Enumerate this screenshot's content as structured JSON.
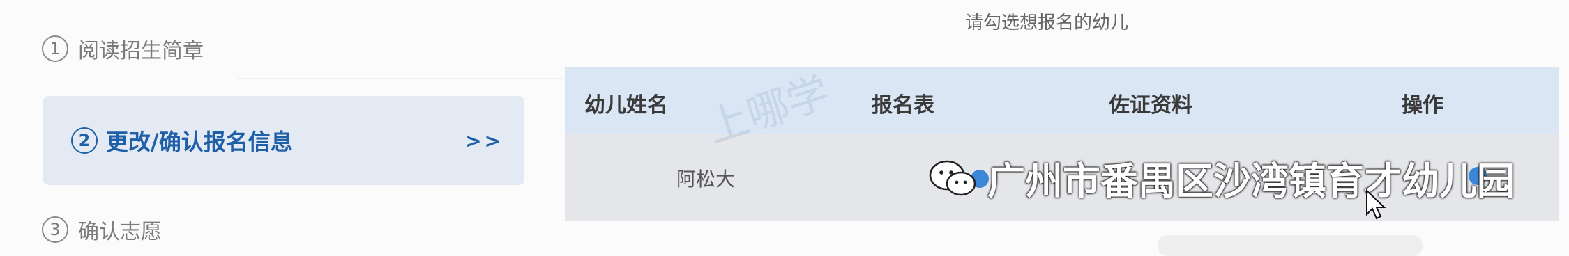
{
  "hint_text": "请勾选想报名的幼儿",
  "steps": [
    {
      "num": "1",
      "label": "阅读招生简章"
    },
    {
      "num": "2",
      "label": "更改/确认报名信息",
      "arrows": ">>"
    },
    {
      "num": "3",
      "label": "确认志愿"
    }
  ],
  "table": {
    "headers": [
      "幼儿姓名",
      "报名表",
      "佐证资料",
      "操作"
    ],
    "rows": [
      {
        "name": "阿松大"
      }
    ]
  },
  "watermarks": {
    "faint": "上哪学",
    "brand": "广州市番禺区沙湾镇育才幼儿园"
  },
  "colors": {
    "active_step_bg": "#e3eaf3",
    "active_step_text": "#1e5fa8",
    "table_header_bg": "#dbe6f4",
    "table_body_bg": "#e4e6e9",
    "link_blue": "#3c86d8"
  }
}
